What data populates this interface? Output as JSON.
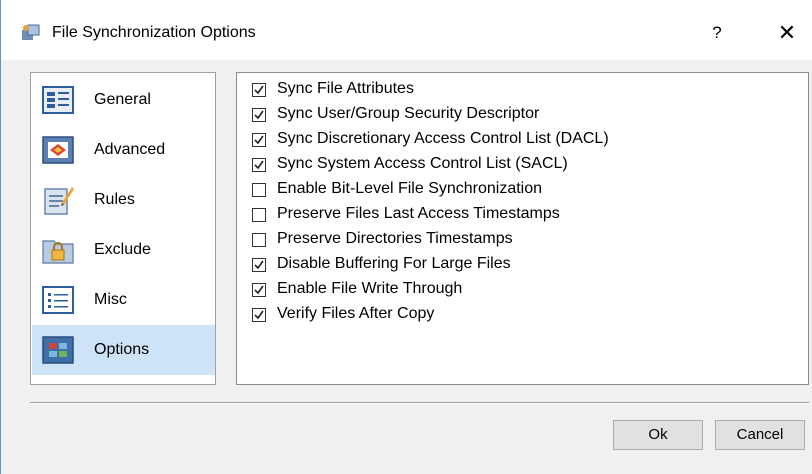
{
  "window": {
    "title": "File Synchronization Options",
    "help_label": "?",
    "close_label": "✕"
  },
  "sidebar": {
    "selected": "Options",
    "items": [
      {
        "label": "General",
        "icon": "general-icon"
      },
      {
        "label": "Advanced",
        "icon": "advanced-icon"
      },
      {
        "label": "Rules",
        "icon": "rules-icon"
      },
      {
        "label": "Exclude",
        "icon": "exclude-lock-folder-icon"
      },
      {
        "label": "Misc",
        "icon": "misc-list-icon"
      },
      {
        "label": "Options",
        "icon": "options-grid-icon"
      }
    ]
  },
  "options": [
    {
      "label": "Sync File Attributes",
      "checked": true
    },
    {
      "label": "Sync User/Group Security Descriptor",
      "checked": true
    },
    {
      "label": "Sync Discretionary Access Control List (DACL)",
      "checked": true
    },
    {
      "label": "Sync System Access Control List (SACL)",
      "checked": true
    },
    {
      "label": "Enable Bit-Level File Synchronization",
      "checked": false
    },
    {
      "label": "Preserve Files Last Access Timestamps",
      "checked": false
    },
    {
      "label": "Preserve Directories Timestamps",
      "checked": false
    },
    {
      "label": "Disable Buffering For Large Files",
      "checked": true
    },
    {
      "label": "Enable File Write Through",
      "checked": true
    },
    {
      "label": "Verify Files After Copy",
      "checked": true
    }
  ],
  "buttons": {
    "ok": "Ok",
    "cancel": "Cancel"
  },
  "colors": {
    "selection": "#cde3f7",
    "window_border": "#6b8fc7"
  }
}
